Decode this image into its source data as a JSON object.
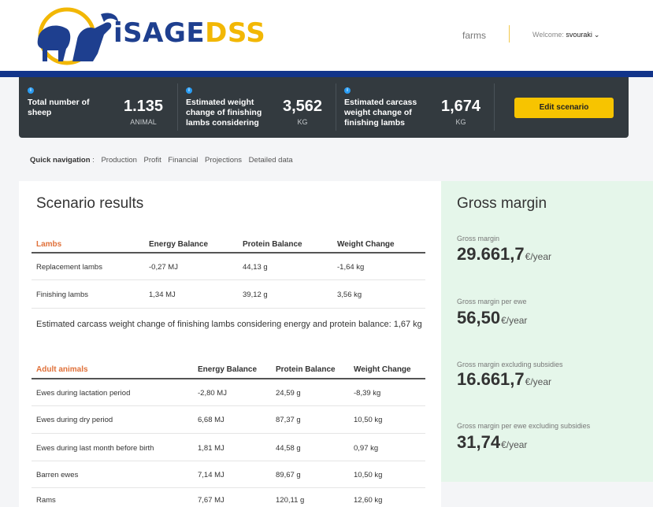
{
  "header": {
    "logo_part1": "iSAGE",
    "logo_part2": "DSS",
    "nav_farms": "farms",
    "welcome_label": "Welcome:",
    "username": "svouraki",
    "colors": {
      "primary_blue": "#1e3f8f",
      "brand_yellow": "#f2b705"
    }
  },
  "stats": [
    {
      "label": "Total number of sheep",
      "value": "1.135",
      "unit": "ANIMAL"
    },
    {
      "label": "Estimated weight change of finishing lambs considering",
      "value": "3,562",
      "unit": "KG"
    },
    {
      "label": "Estimated carcass weight change of finishing lambs",
      "value": "1,674",
      "unit": "KG"
    }
  ],
  "edit_button": "Edit scenario",
  "quick_nav": {
    "label": "Quick navigation",
    "separator": ":",
    "links": [
      "Production",
      "Profit",
      "Financial",
      "Projections",
      "Detailed data"
    ]
  },
  "results": {
    "title": "Scenario results",
    "lambs_table": {
      "headers": [
        "Lambs",
        "Energy Balance",
        "Protein Balance",
        "Weight Change"
      ],
      "rows": [
        [
          "Replacement lambs",
          "-0,27 MJ",
          "44,13 g",
          "-1,64 kg"
        ],
        [
          "Finishing lambs",
          "1,34 MJ",
          "39,12 g",
          "3,56 kg"
        ]
      ]
    },
    "note": "Estimated carcass weight change of finishing lambs considering energy and protein balance: 1,67 kg",
    "adult_table": {
      "headers": [
        "Adult animals",
        "Energy Balance",
        "Protein Balance",
        "Weight Change"
      ],
      "rows": [
        [
          "Ewes during lactation period",
          "-2,80 MJ",
          "24,59 g",
          "-8,39 kg"
        ],
        [
          "Ewes during dry period",
          "6,68 MJ",
          "87,37 g",
          "10,50 kg"
        ],
        [
          "Ewes during last month before birth",
          "1,81 MJ",
          "44,58 g",
          "0,97 kg"
        ],
        [
          "Barren ewes",
          "7,14 MJ",
          "89,67 g",
          "10,50 kg"
        ],
        [
          "Rams",
          "7,67 MJ",
          "120,11 g",
          "12,60 kg"
        ]
      ]
    }
  },
  "gross_margin": {
    "title": "Gross margin",
    "items": [
      {
        "label": "Gross margin",
        "value": "29.661,7",
        "unit": "€/year"
      },
      {
        "label": "Gross margin per ewe",
        "value": "56,50",
        "unit": "€/year"
      },
      {
        "label": "Gross margin excluding subsidies",
        "value": "16.661,7",
        "unit": "€/year"
      },
      {
        "label": "Gross margin per ewe excluding subsidies",
        "value": "31,74",
        "unit": "€/year"
      }
    ]
  }
}
